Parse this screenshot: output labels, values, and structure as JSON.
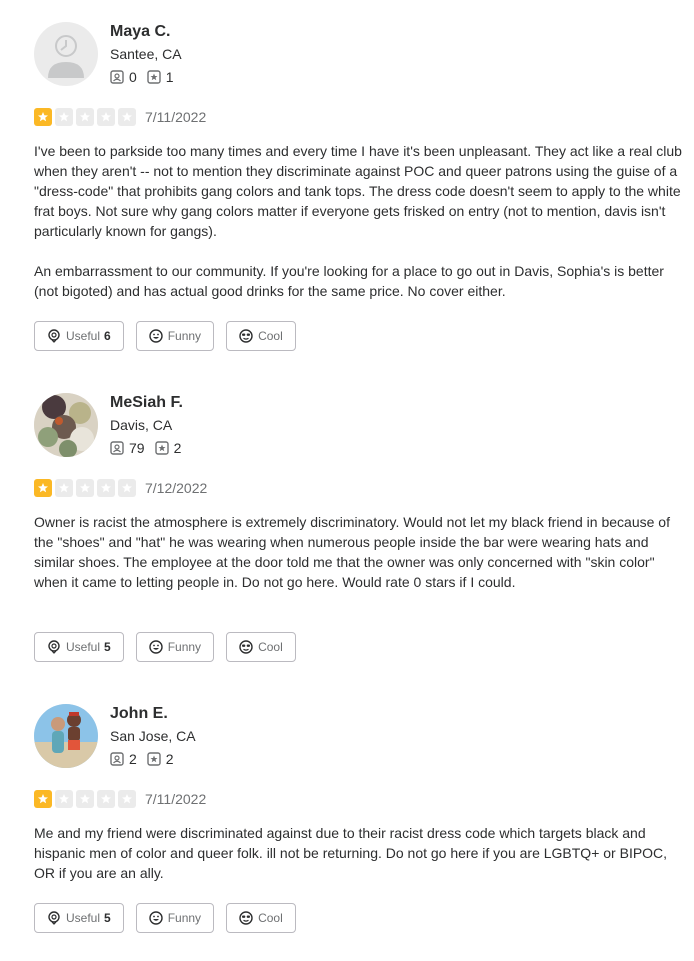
{
  "reviews": [
    {
      "user": {
        "name": "Maya C.",
        "location": "Santee, CA",
        "friends": "0",
        "reviews": "1",
        "avatar": "default-avatar"
      },
      "rating": 1,
      "date": "7/11/2022",
      "paragraphs": [
        "I've been to parkside too many times and every time I have it's been unpleasant. They act like a real club when they aren't -- not to mention they discriminate against POC and queer patrons using the guise of a \"dress-code\" that prohibits gang colors and tank tops. The dress code doesn't seem to apply to the white frat boys. Not sure why gang colors matter if everyone gets frisked on entry (not to mention, davis isn't particularly known for gangs).",
        "An embarrassment to our community. If you're looking for a place to go out in Davis, Sophia's is better (not bigoted) and has actual good drinks for the same price. No cover either."
      ],
      "actions": {
        "useful_label": "Useful",
        "useful_count": "6",
        "funny_label": "Funny",
        "cool_label": "Cool"
      }
    },
    {
      "user": {
        "name": "MeSiah F.",
        "location": "Davis, CA",
        "friends": "79",
        "reviews": "2",
        "avatar": "food-photo-avatar"
      },
      "rating": 1,
      "date": "7/12/2022",
      "paragraphs": [
        "Owner is racist the atmosphere is extremely discriminatory. Would not let my black friend in because of the \"shoes\" and \"hat\" he was wearing when numerous people inside the bar were wearing hats and similar shoes. The employee at the door told me that the owner was only concerned with \"skin color\" when it came to letting people in. Do not go here. Would rate 0 stars if I could."
      ],
      "actions": {
        "useful_label": "Useful",
        "useful_count": "5",
        "funny_label": "Funny",
        "cool_label": "Cool"
      }
    },
    {
      "user": {
        "name": "John E.",
        "location": "San Jose, CA",
        "friends": "2",
        "reviews": "2",
        "avatar": "beach-photo-avatar"
      },
      "rating": 1,
      "date": "7/11/2022",
      "paragraphs": [
        "Me and my friend were discriminated against due to their racist dress code which targets black and hispanic men of color and queer folk.  ill not be returning. Do not go here if you are LGBTQ+ or BIPOC, OR if you are an ally."
      ],
      "actions": {
        "useful_label": "Useful",
        "useful_count": "5",
        "funny_label": "Funny",
        "cool_label": "Cool"
      }
    }
  ],
  "colors": {
    "star_filled": "#fbb825",
    "star_empty": "#ebebeb",
    "text": "#2d2e2f",
    "muted": "#6e7072",
    "border": "#bbbac0"
  }
}
